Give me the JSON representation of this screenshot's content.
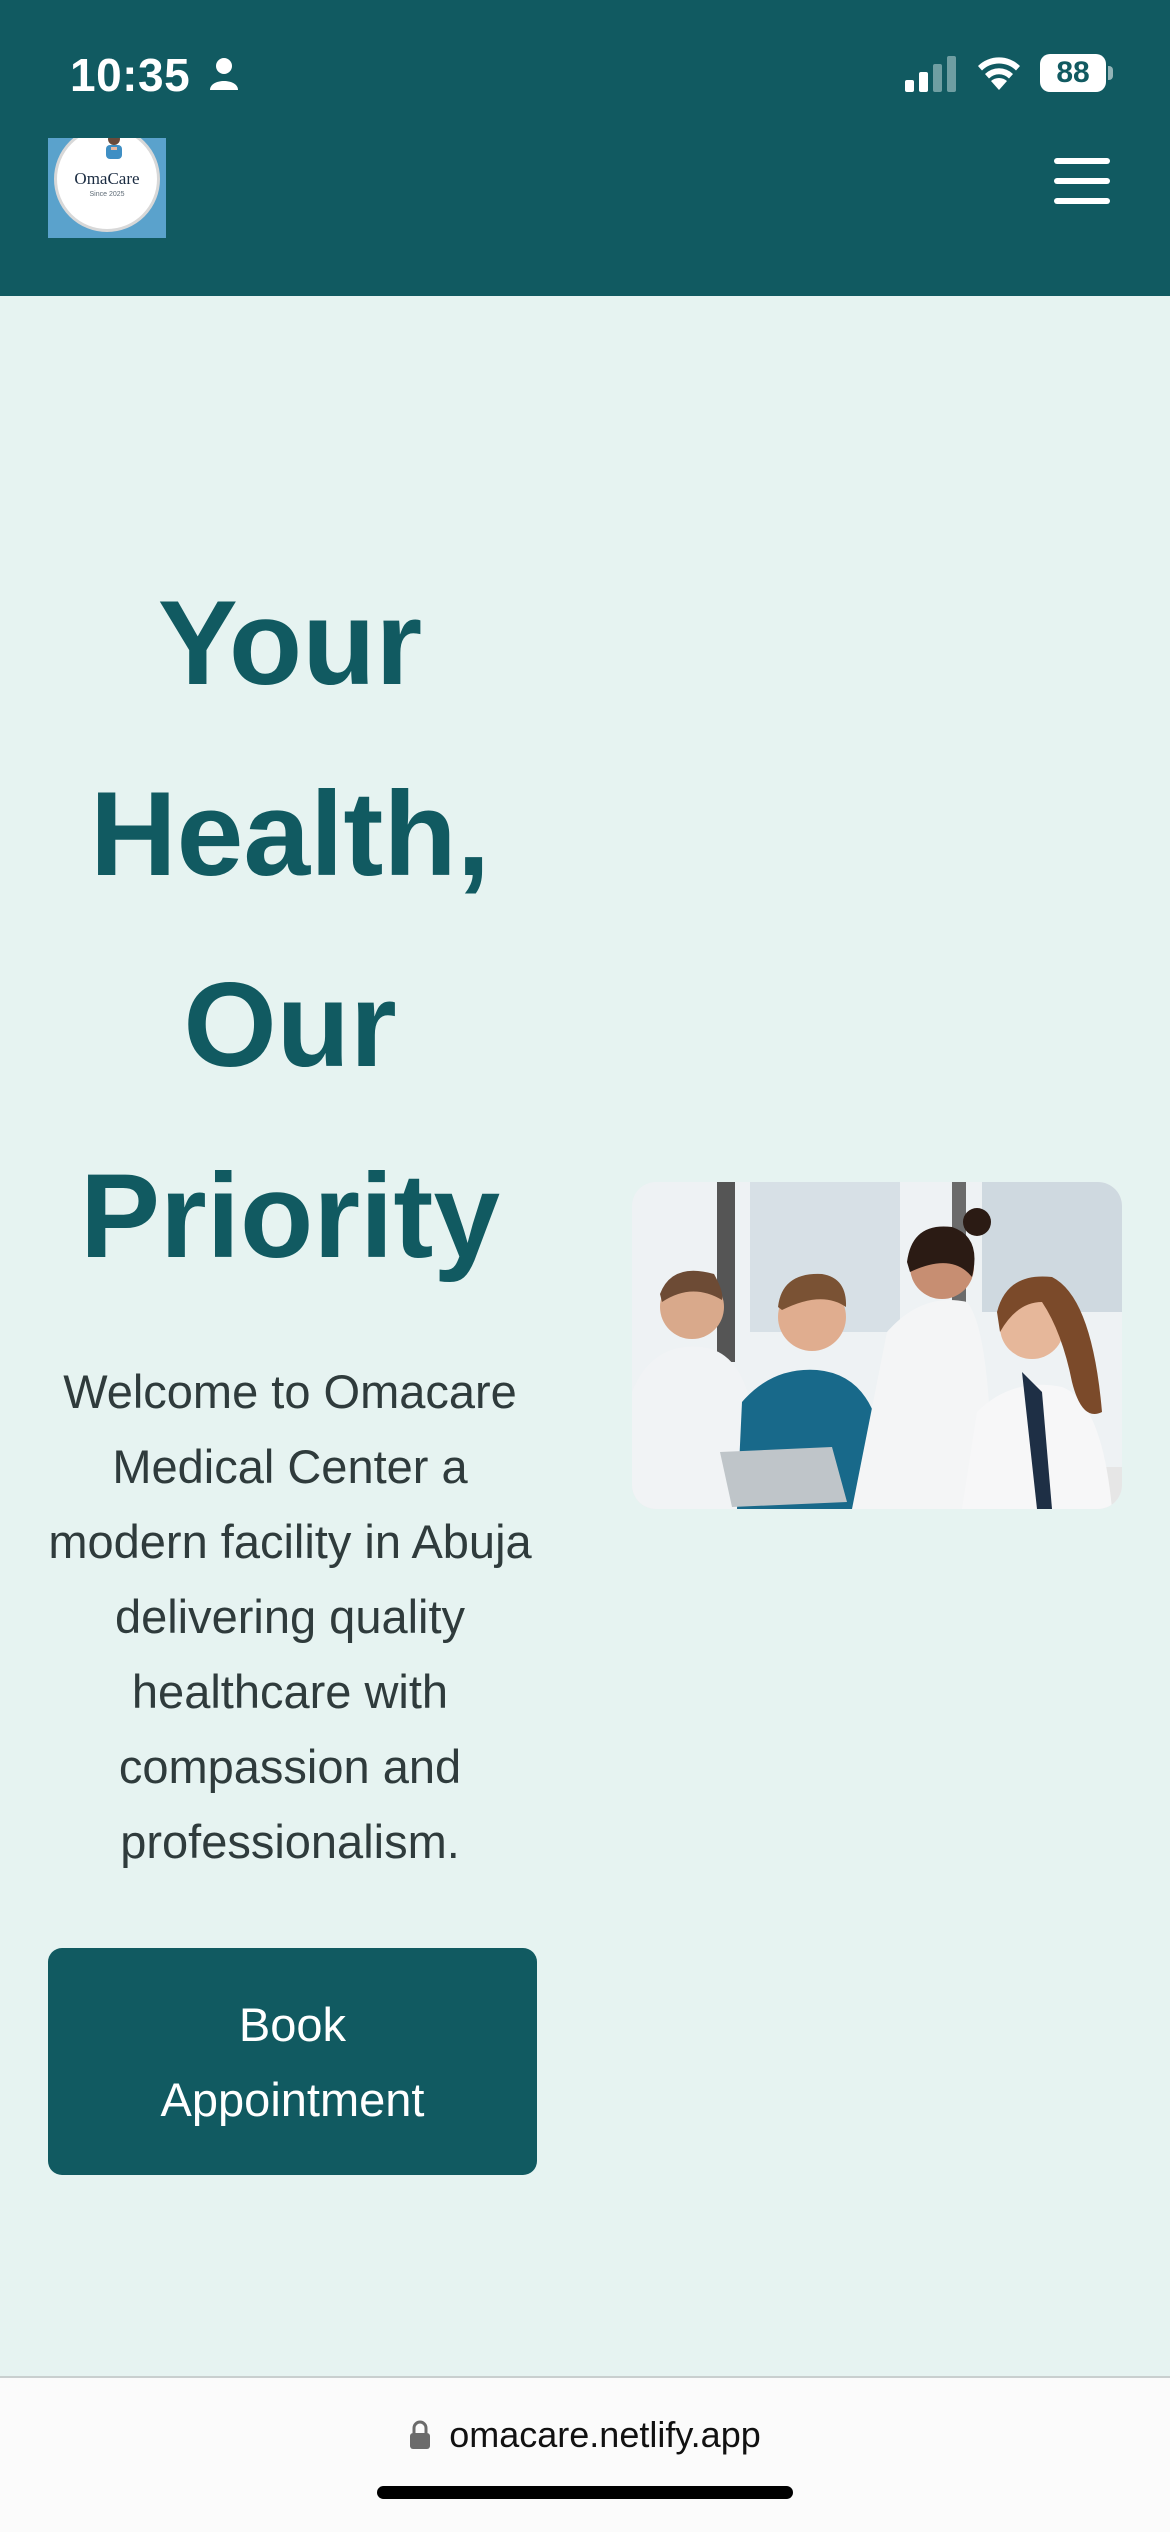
{
  "status_bar": {
    "time": "10:35",
    "battery": "88",
    "icons": [
      "person-icon",
      "signal-icon",
      "wifi-icon",
      "battery-icon"
    ]
  },
  "header": {
    "logo": {
      "name": "OmaCare",
      "since": "Since 2025"
    },
    "menu_icon": "hamburger-icon",
    "bg_color": "#115a61"
  },
  "hero": {
    "title_lines": [
      "Your",
      "Health,",
      "Our",
      "Priority"
    ],
    "description": "Welcome to Omacare Medical Center a modern facility in Abuja delivering quality healthcare with compassion and professionalism.",
    "cta_label": "Book Appointment",
    "image_alt": "Doctors discussing around a laptop"
  },
  "browser": {
    "url": "omacare.netlify.app",
    "lock_icon": "lock-icon"
  },
  "colors": {
    "primary": "#115a61",
    "background": "#e6f3f1",
    "text": "#2f3b3c"
  }
}
